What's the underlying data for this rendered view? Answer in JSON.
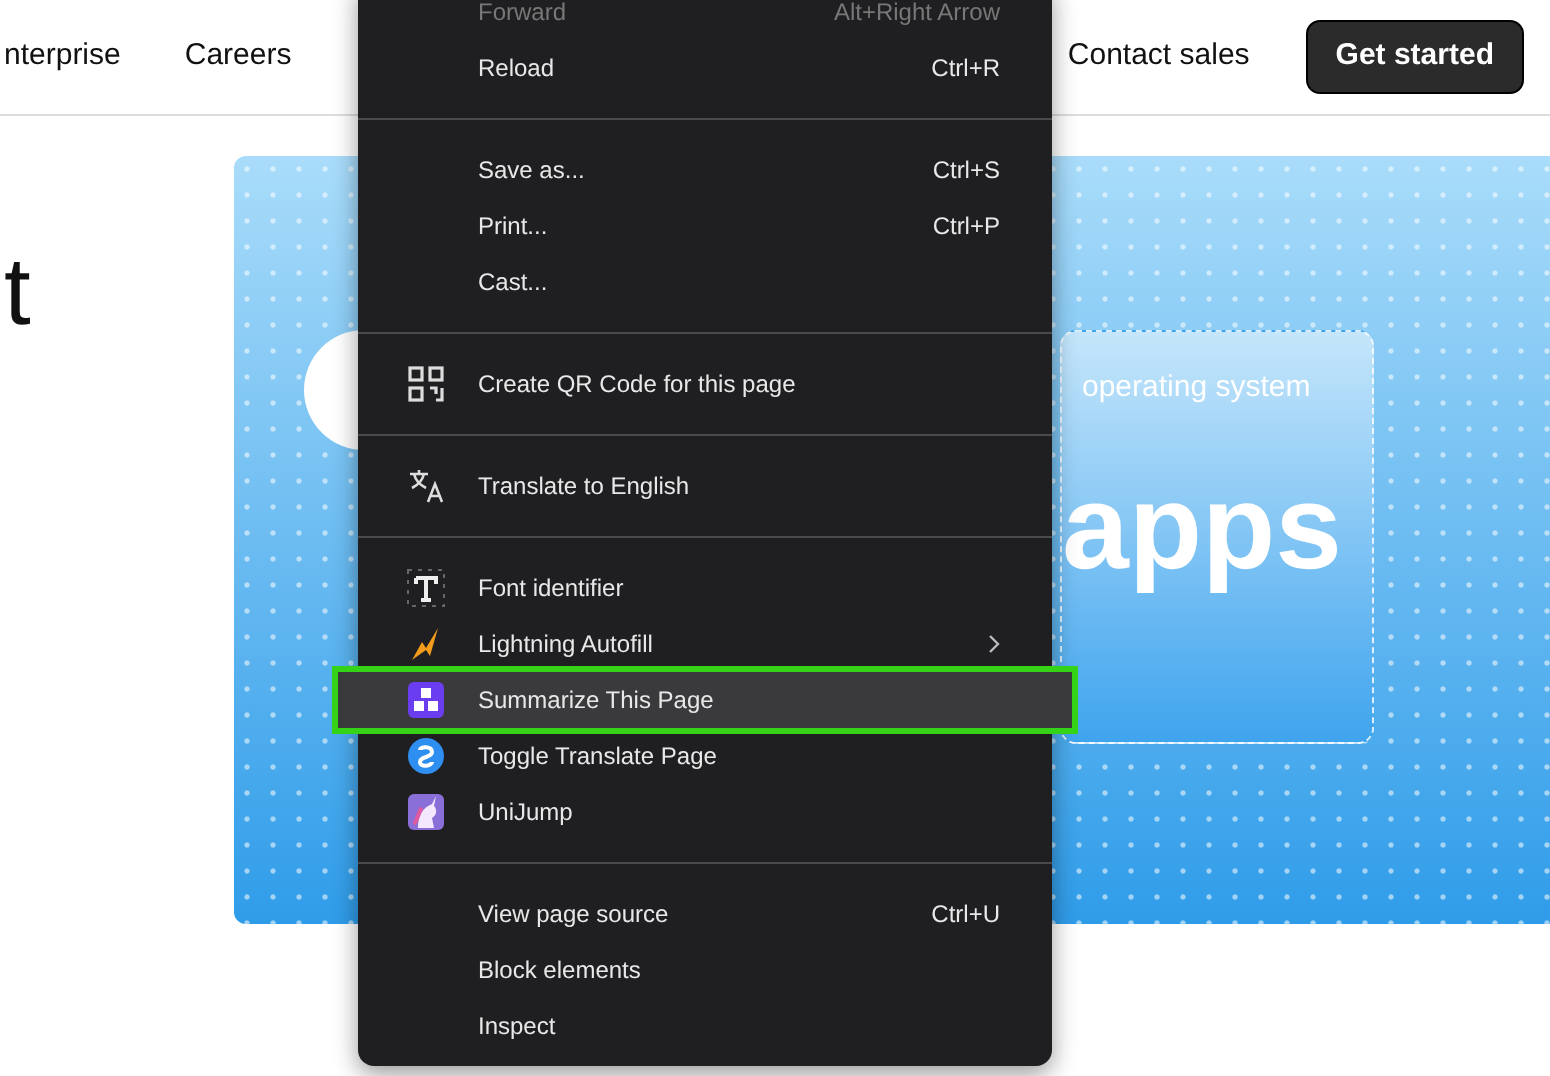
{
  "nav": {
    "links": [
      "nterprise",
      "Careers"
    ],
    "contact": "Contact sales",
    "cta": "Get started"
  },
  "hero": {
    "heading_fragment": "t",
    "card_caption": "operating system",
    "card_word": "apps"
  },
  "context_menu": {
    "groups": [
      [
        {
          "label": "Forward",
          "shortcut": "Alt+Right Arrow",
          "disabled": true,
          "selected": false,
          "submenu": false
        },
        {
          "label": "Reload",
          "shortcut": "Ctrl+R",
          "disabled": false,
          "selected": false,
          "submenu": false
        }
      ],
      [
        {
          "label": "Save as...",
          "shortcut": "Ctrl+S",
          "disabled": false,
          "selected": false,
          "submenu": false
        },
        {
          "label": "Print...",
          "shortcut": "Ctrl+P",
          "disabled": false,
          "selected": false,
          "submenu": false
        },
        {
          "label": "Cast...",
          "disabled": false,
          "selected": false,
          "submenu": false
        }
      ],
      [
        {
          "label": "Create QR Code for this page",
          "disabled": false,
          "selected": false,
          "submenu": false
        }
      ],
      [
        {
          "label": "Translate to English",
          "disabled": false,
          "selected": false,
          "submenu": false
        }
      ],
      [
        {
          "label": "Font identifier",
          "disabled": false,
          "selected": false,
          "submenu": false
        },
        {
          "label": "Lightning Autofill",
          "disabled": false,
          "selected": false,
          "submenu": true
        },
        {
          "label": "Summarize This Page",
          "disabled": false,
          "selected": true,
          "submenu": false
        },
        {
          "label": "Toggle Translate Page",
          "disabled": false,
          "selected": false,
          "submenu": false
        },
        {
          "label": "UniJump",
          "disabled": false,
          "selected": false,
          "submenu": false
        }
      ],
      [
        {
          "label": "View page source",
          "shortcut": "Ctrl+U",
          "disabled": false,
          "selected": false,
          "submenu": false
        },
        {
          "label": "Block elements",
          "disabled": false,
          "selected": false,
          "submenu": false
        },
        {
          "label": "Inspect",
          "disabled": false,
          "selected": false,
          "submenu": false
        }
      ]
    ]
  }
}
